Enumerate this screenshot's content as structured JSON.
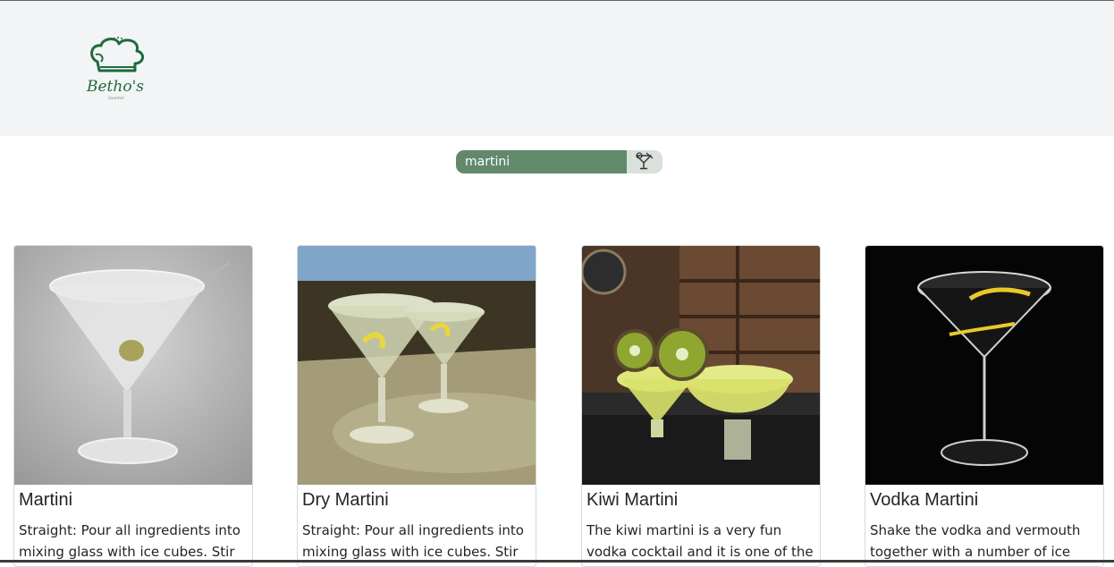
{
  "brand": {
    "logo_text": "Betho's",
    "logo_subtext": "Gourmet"
  },
  "search": {
    "value": "martini",
    "button_icon": "cocktail-glass-icon"
  },
  "cards": [
    {
      "title": "Martini",
      "description": "Straight: Pour all ingredients into mixing glass with ice cubes. Stir well."
    },
    {
      "title": "Dry Martini",
      "description": "Straight: Pour all ingredients into mixing glass with ice cubes. Stir well."
    },
    {
      "title": "Kiwi Martini",
      "description": "The kiwi martini is a very fun vodka cocktail and it is one of the best"
    },
    {
      "title": "Vodka Martini",
      "description": "Shake the vodka and vermouth together with a number of ice"
    }
  ],
  "colors": {
    "header_bg": "#f3f4f6",
    "brand_green": "#1e6b3a",
    "search_bg": "#62896c",
    "search_button_bg": "#d9e1da"
  }
}
